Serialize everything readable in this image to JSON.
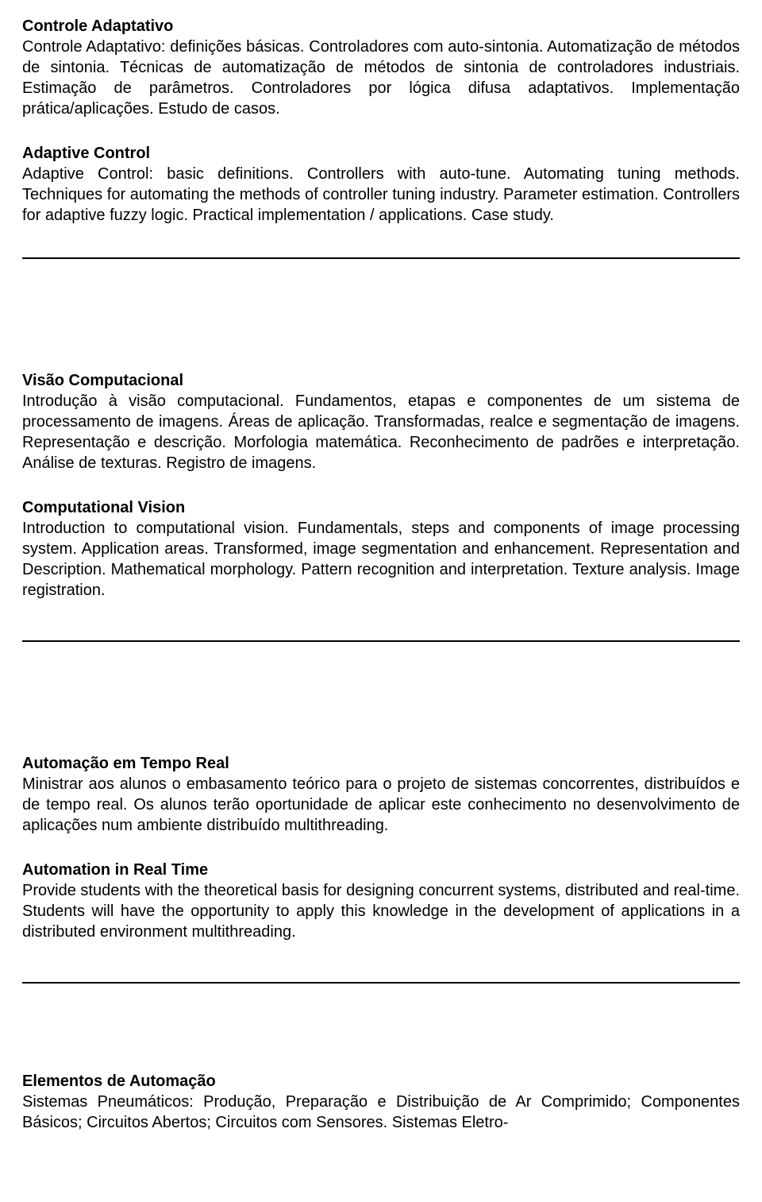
{
  "sections": [
    {
      "title_pt": "Controle Adaptativo",
      "body_pt": "Controle Adaptativo: definições básicas. Controladores com auto-sintonia. Automatização de métodos de sintonia. Técnicas de automatização de métodos de sintonia de controladores industriais. Estimação de parâmetros. Controladores por lógica difusa adaptativos. Implementação prática/aplicações. Estudo de casos.",
      "title_en": "Adaptive Control",
      "body_en": "Adaptive Control: basic definitions. Controllers with auto-tune. Automating tuning methods. Techniques for automating the methods of controller tuning industry. Parameter estimation. Controllers for adaptive fuzzy logic. Practical implementation / applications. Case study."
    },
    {
      "title_pt": "Visão Computacional",
      "body_pt": "Introdução à visão computacional. Fundamentos, etapas e componentes de um sistema de processamento de imagens. Áreas de aplicação. Transformadas, realce e segmentação de imagens. Representação e descrição. Morfologia matemática. Reconhecimento de padrões e interpretação. Análise de texturas. Registro de imagens.",
      "title_en": "Computational Vision",
      "body_en": "Introduction to computational vision. Fundamentals, steps and components of image processing system. Application areas. Transformed, image segmentation and enhancement. Representation and Description. Mathematical morphology. Pattern recognition and interpretation. Texture analysis. Image registration."
    },
    {
      "title_pt": "Automação em Tempo Real",
      "body_pt": "Ministrar aos alunos o embasamento teórico para o projeto de sistemas concorrentes, distribuídos e de tempo real. Os alunos terão oportunidade de aplicar este conhecimento no desenvolvimento de aplicações num ambiente distribuído multithreading.",
      "title_en": "Automation in Real Time",
      "body_en": "Provide students with the theoretical basis for designing concurrent systems, distributed and real-time. Students will have the opportunity to apply this knowledge in the development of applications in a distributed environment multithreading."
    },
    {
      "title_pt": "Elementos de Automação",
      "body_pt": "Sistemas Pneumáticos: Produção, Preparação e Distribuição de Ar Comprimido; Componentes Básicos; Circuitos Abertos; Circuitos com Sensores. Sistemas Eletro-"
    }
  ]
}
